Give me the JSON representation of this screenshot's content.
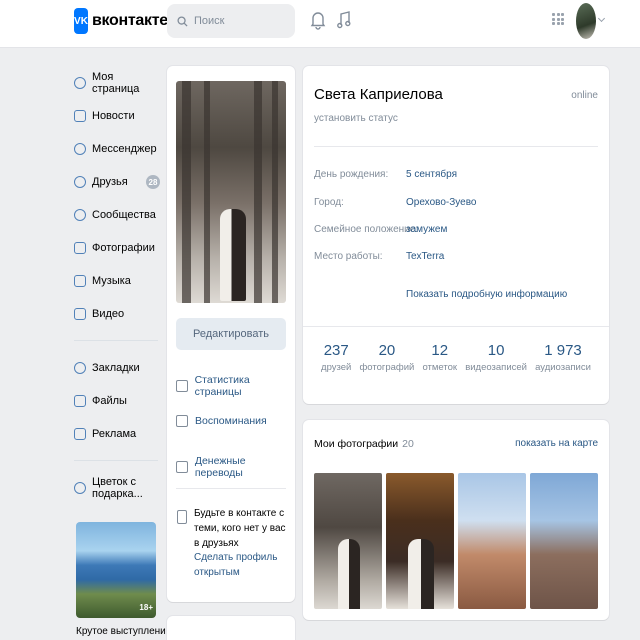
{
  "header": {
    "logo_text": "вконтакте",
    "logo_badge": "VK",
    "search_placeholder": "Поиск"
  },
  "menu": {
    "items": [
      {
        "label": "Моя страница",
        "icon": "user-icon"
      },
      {
        "label": "Новости",
        "icon": "news-icon"
      },
      {
        "label": "Мессенджер",
        "icon": "messenger-icon"
      },
      {
        "label": "Друзья",
        "icon": "friends-icon",
        "badge": "28"
      },
      {
        "label": "Сообщества",
        "icon": "communities-icon"
      },
      {
        "label": "Фотографии",
        "icon": "photos-icon"
      },
      {
        "label": "Музыка",
        "icon": "music-icon"
      },
      {
        "label": "Видео",
        "icon": "video-icon"
      },
      {
        "label": "Закладки",
        "icon": "bookmark-icon"
      },
      {
        "label": "Файлы",
        "icon": "file-icon"
      },
      {
        "label": "Реклама",
        "icon": "ads-icon"
      },
      {
        "label": "Цветок с подарка...",
        "icon": "app-icon"
      }
    ],
    "promo_badge": "18+",
    "promo_caption": "Крутое выступление!"
  },
  "profile": {
    "edit_button": "Редактировать",
    "links": [
      {
        "label": "Статистика страницы",
        "icon": "stats-icon"
      },
      {
        "label": "Воспоминания",
        "icon": "memories-icon"
      },
      {
        "label": "Денежные переводы",
        "icon": "money-transfer-icon"
      }
    ],
    "privacy_text": "Будьте в контакте с теми, кого нет у вас в друзьях",
    "privacy_link": "Сделать профиль открытым"
  },
  "info": {
    "name": "Света Каприелова",
    "online": "online",
    "status": "установить статус",
    "rows": [
      {
        "label": "День рождения:",
        "value": "5 сентября"
      },
      {
        "label": "Город:",
        "value": "Орехово-Зуево"
      },
      {
        "label": "Семейное положение:",
        "value": "замужем"
      },
      {
        "label": "Место работы:",
        "value": "TexTerra"
      }
    ],
    "more_link": "Показать подробную информацию",
    "counters": [
      {
        "num": "237",
        "label": "друзей"
      },
      {
        "num": "20",
        "label": "фотографий"
      },
      {
        "num": "12",
        "label": "отметок"
      },
      {
        "num": "10",
        "label": "видеозаписей"
      },
      {
        "num": "1 973",
        "label": "аудиозаписи"
      }
    ]
  },
  "photos": {
    "title": "Мои фотографии",
    "count": "20",
    "map_link": "показать на карте"
  }
}
